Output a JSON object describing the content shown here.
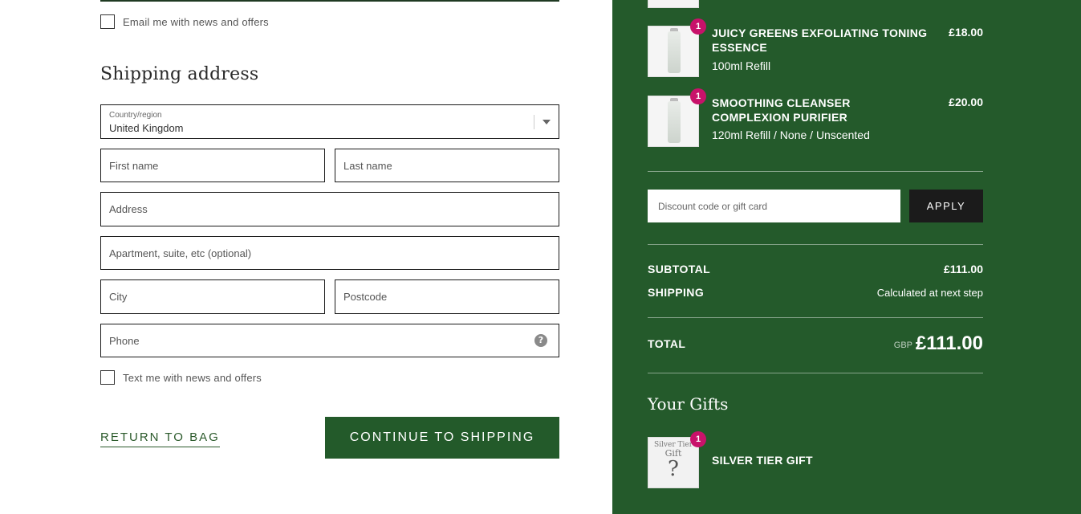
{
  "form": {
    "email_opt_in_label": "Email me with news and offers",
    "shipping_title": "Shipping address",
    "country": {
      "label": "Country/region",
      "value": "United Kingdom"
    },
    "first_name_placeholder": "First name",
    "last_name_placeholder": "Last name",
    "address_placeholder": "Address",
    "apartment_placeholder": "Apartment, suite, etc (optional)",
    "city_placeholder": "City",
    "postcode_placeholder": "Postcode",
    "phone_placeholder": "Phone",
    "phone_help_glyph": "?",
    "sms_opt_in_label": "Text me with news and offers",
    "return_label": "RETURN TO BAG",
    "continue_label": "CONTINUE TO SHIPPING"
  },
  "summary": {
    "products": [
      {
        "name": "JUICY GREENS EXFOLIATING TONING ESSENCE",
        "variant": "100ml Refill",
        "price": "£18.00",
        "quantity": "1"
      },
      {
        "name": "SMOOTHING CLEANSER COMPLEXION PURIFIER",
        "variant": "120ml Refill / None / Unscented",
        "price": "£20.00",
        "quantity": "1"
      }
    ],
    "discount_placeholder": "Discount code or gift card",
    "apply_label": "APPLY",
    "subtotal_label": "SUBTOTAL",
    "subtotal_value": "£111.00",
    "shipping_label": "SHIPPING",
    "shipping_value": "Calculated at next step",
    "total_label": "TOTAL",
    "currency": "GBP",
    "total_value": "£111.00",
    "gifts_title": "Your Gifts",
    "gift": {
      "name": "SILVER TIER GIFT",
      "quantity": "1",
      "thumb_line1": "Silver Tier",
      "thumb_line2": "Gift",
      "thumb_glyph": "?"
    }
  },
  "colors": {
    "panel_green": "#245a2b",
    "button_green": "#235a2a",
    "badge_pink": "#c8126a",
    "apply_black": "#1b1b1b"
  }
}
